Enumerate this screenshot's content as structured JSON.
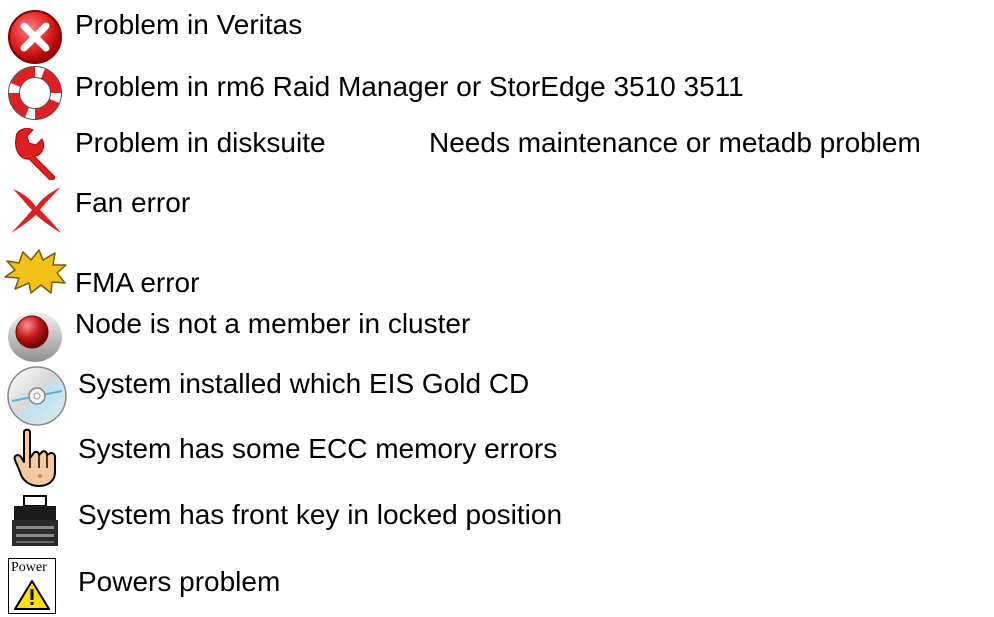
{
  "legend": {
    "veritas": {
      "icon": "red-x-circle-icon",
      "label": "Problem in Veritas"
    },
    "rm6": {
      "icon": "lifebuoy-icon",
      "label": "Problem in rm6 Raid Manager or StorEdge 3510 3511"
    },
    "disksuite": {
      "icon": "red-wrench-icon",
      "label": "Problem in disksuite",
      "note": "Needs maintenance or metadb problem"
    },
    "fan": {
      "icon": "red-fan-x-icon",
      "label": "Fan error"
    },
    "fma": {
      "icon": "yellow-burst-icon",
      "label": "FMA error"
    },
    "cluster": {
      "icon": "red-button-icon",
      "label": "Node is not a member in cluster"
    },
    "eis": {
      "icon": "cd-disc-icon",
      "label": "System installed which EIS Gold CD"
    },
    "ecc": {
      "icon": "pointing-hand-icon",
      "label": "System has some ECC memory errors"
    },
    "frontkey": {
      "icon": "locked-key-icon",
      "label": "System has front key in locked position"
    },
    "power": {
      "icon": "power-warning-icon",
      "label": "Powers problem",
      "icon_text": "Power"
    }
  },
  "colors": {
    "error_red": "#e02020",
    "burst_yellow": "#f2c21b",
    "warning_yellow": "#ffe000"
  }
}
